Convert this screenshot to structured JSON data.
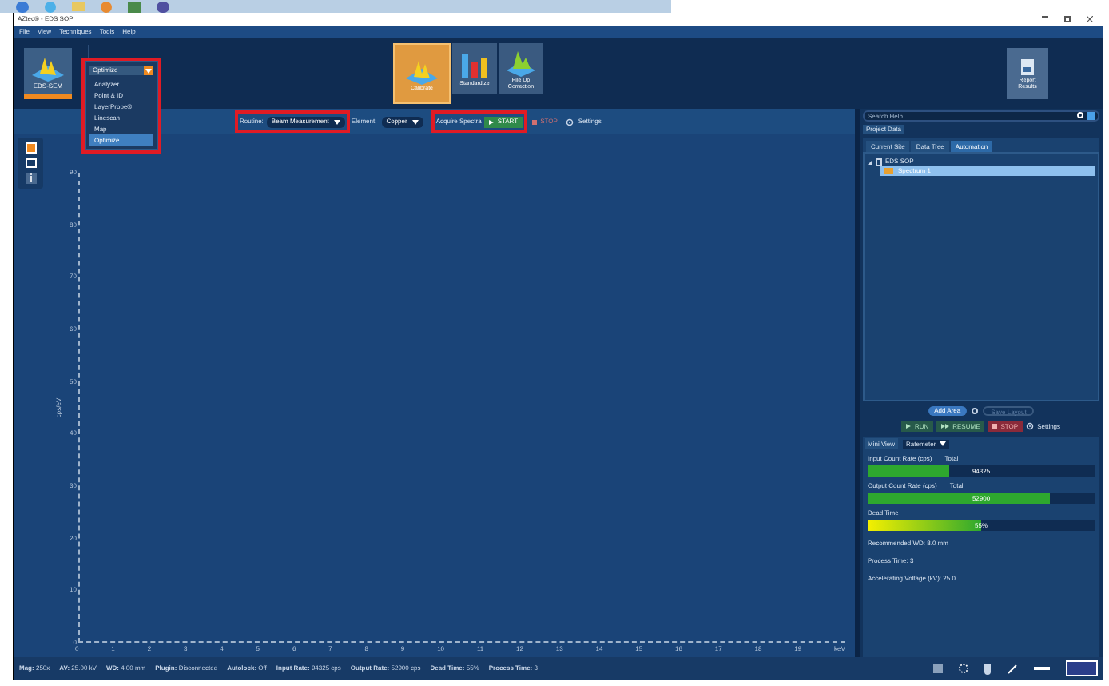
{
  "window": {
    "title": "AZtec® - EDS SOP"
  },
  "menu": [
    "File",
    "View",
    "Techniques",
    "Tools",
    "Help"
  ],
  "mode_tile": {
    "label": "EDS-SEM"
  },
  "navigator": {
    "highlighted": true,
    "value": "Optimize",
    "items": [
      {
        "label": "Analyzer",
        "selected": false
      },
      {
        "label": "Point & ID",
        "selected": false
      },
      {
        "label": "LayerProbe®",
        "selected": false
      },
      {
        "label": "Linescan",
        "selected": false
      },
      {
        "label": "Map",
        "selected": false
      },
      {
        "label": "Optimize",
        "selected": true
      }
    ]
  },
  "ribbon": [
    {
      "label": "Calibrate",
      "selected": true,
      "kind": "calibrate"
    },
    {
      "label": "Standardize",
      "selected": false,
      "kind": "standardize"
    },
    {
      "label": "Pile Up Correction",
      "selected": false,
      "kind": "pileup"
    }
  ],
  "report_button": {
    "label": "Report Results"
  },
  "toolbar": {
    "routine": {
      "label": "Routine:",
      "value": "Beam Measurement",
      "highlighted": true
    },
    "element": {
      "label": "Element:",
      "value": "Copper"
    },
    "acquire": {
      "label": "Acquire Spectra",
      "start": "START",
      "highlighted": true
    },
    "stop": "STOP",
    "settings": "Settings"
  },
  "spectrum": {
    "y_label": "cps/eV",
    "y_ticks": [
      "90",
      "80",
      "70",
      "60",
      "50",
      "40",
      "30",
      "20",
      "10",
      "0"
    ],
    "x_ticks": [
      "0",
      "1",
      "2",
      "3",
      "4",
      "5",
      "6",
      "7",
      "8",
      "9",
      "10",
      "11",
      "12",
      "13",
      "14",
      "15",
      "16",
      "17",
      "18",
      "19"
    ],
    "x_unit": "keV"
  },
  "right_panel": {
    "search": {
      "placeholder": "Search Help"
    },
    "project_title": "Project Data",
    "tabs": [
      {
        "label": "Current Site",
        "selected": false
      },
      {
        "label": "Data Tree",
        "selected": false
      },
      {
        "label": "Automation",
        "selected": true
      }
    ],
    "tree": [
      {
        "label": "EDS SOP",
        "expanded": true,
        "selected": false,
        "children": [
          {
            "label": "Spectrum 1",
            "selected": true
          }
        ]
      }
    ],
    "add_area": "Add Area",
    "save_layout": {
      "label": "Save Layout",
      "disabled": true
    },
    "run_buttons": [
      {
        "label": "RUN",
        "kind": "run"
      },
      {
        "label": "RESUME",
        "kind": "resume"
      },
      {
        "label": "STOP",
        "kind": "stop"
      }
    ],
    "settings": "Settings",
    "mini_view": {
      "title": "Mini View",
      "dropdown": "Ratemeter",
      "meters": [
        {
          "label": "Input Count Rate (cps)",
          "total_label": "Total",
          "reading": "94325",
          "level": 0.36,
          "kind": "green"
        },
        {
          "label": "Output Count Rate (cps)",
          "total_label": "Total",
          "reading": "52900",
          "level": 0.8,
          "kind": "green"
        },
        {
          "label": "Dead Time",
          "reading": "55%",
          "level": 0.5,
          "kind": "gradient"
        }
      ],
      "info": [
        "Recommended WD: 8.0 mm",
        "Process Time: 3",
        "Accelerating Voltage (kV): 25.0"
      ]
    }
  },
  "status_bar": [
    {
      "label": "Mag:",
      "value": "250x"
    },
    {
      "label": "AV:",
      "value": "25.00 kV"
    },
    {
      "label": "WD:",
      "value": "4.00 mm"
    },
    {
      "label": "Plugin:",
      "value": "Disconnected"
    },
    {
      "label": "Autolock:",
      "value": "Off"
    },
    {
      "label": "Input Rate:",
      "value": "94325 cps"
    },
    {
      "label": "Output Rate:",
      "value": "52900 cps"
    },
    {
      "label": "Dead Time:",
      "value": "55%"
    },
    {
      "label": "Process Time:",
      "value": "3"
    }
  ]
}
